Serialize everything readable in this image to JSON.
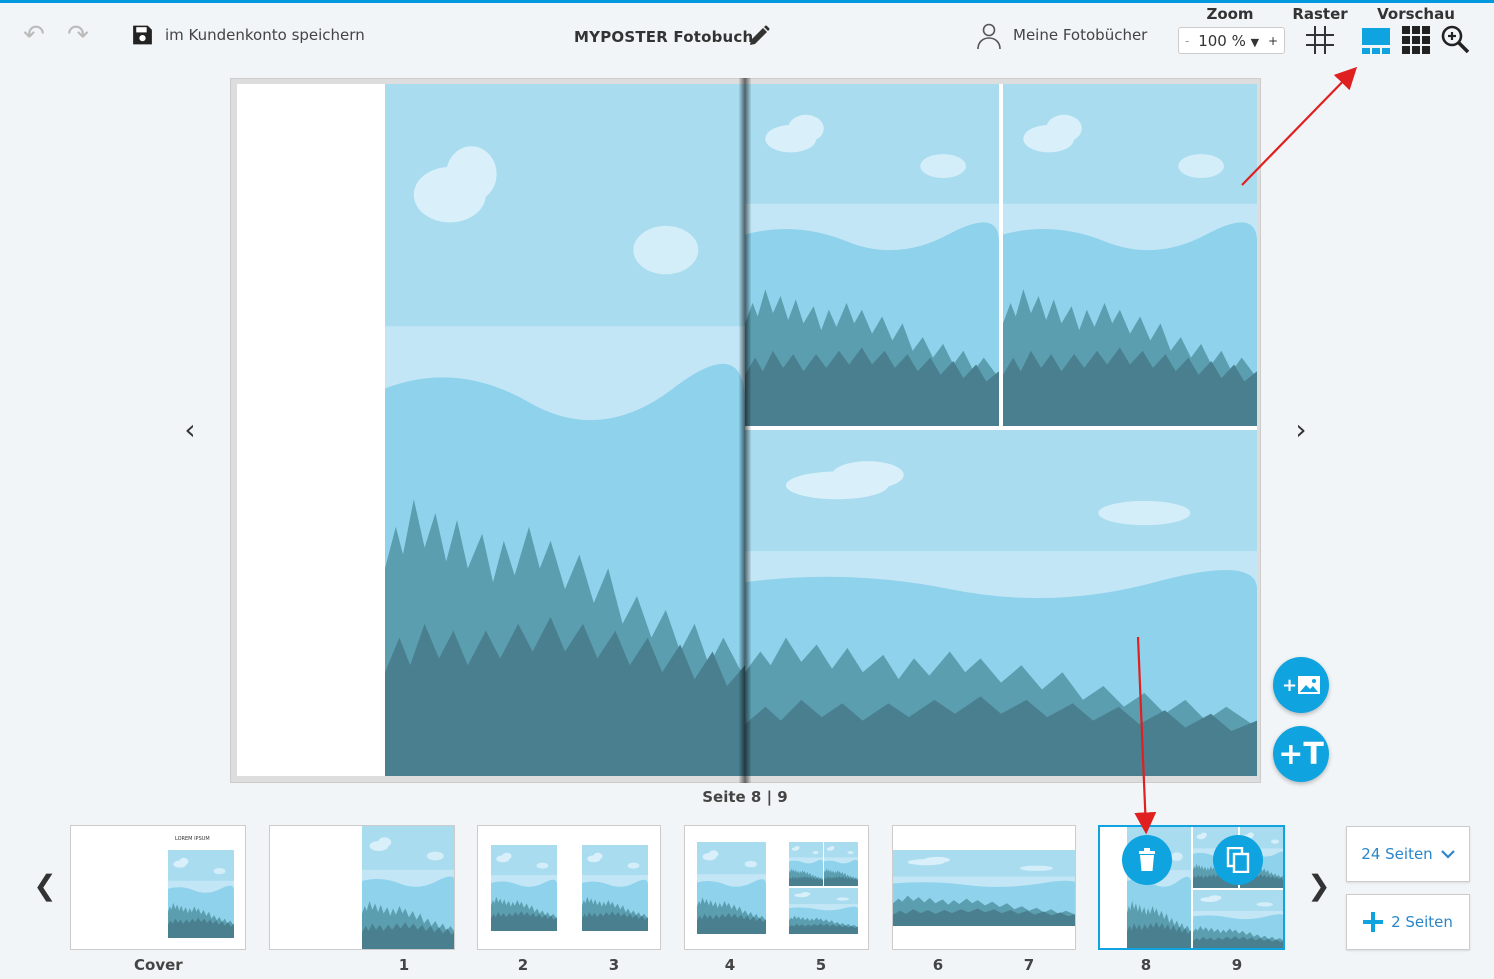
{
  "toolbar": {
    "save_label": "im Kundenkonto speichern",
    "title": "MYPOSTER Fotobuch",
    "my_books_label": "Meine Fotobücher",
    "zoom_heading": "Zoom",
    "zoom_value": "100 %",
    "zoom_minus": "-",
    "zoom_plus": "+",
    "raster_heading": "Raster",
    "preview_heading": "Vorschau",
    "icons": [
      "undo-icon",
      "redo-icon",
      "save-icon",
      "pencil-icon",
      "user-icon",
      "grid-raster-icon",
      "spread-view-icon",
      "grid-view-icon",
      "zoom-search-icon"
    ]
  },
  "canvas": {
    "page_indicator": "Seite 8 | 9",
    "prev_arrow": "‹",
    "next_arrow": "›"
  },
  "fabs": {
    "add_image": "+",
    "add_text": "+T"
  },
  "thumbnails": {
    "labels": [
      "Cover",
      "1",
      "2",
      "3",
      "4",
      "5",
      "6",
      "7",
      "8",
      "9"
    ],
    "cover_text": "LOREM IPSUM",
    "selected": "8 | 9"
  },
  "strip": {
    "prev_arrow": "❮",
    "next_arrow": "❯",
    "pages_select": "24 Seiten",
    "add_pages": "2 Seiten"
  },
  "colors": {
    "accent": "#0fa3df",
    "sky": "#bfe4f3",
    "mountain": "#8fd2ec",
    "forest_light": "#5b9eb0",
    "forest_dark": "#4a7f8f",
    "annotation_arrow": "#e02020"
  }
}
